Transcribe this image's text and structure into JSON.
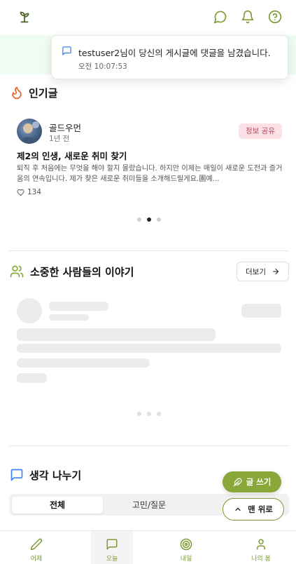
{
  "notification": {
    "message": "testuser2님이 당신의 게시글에 댓글을 남겼습니다.",
    "time": "오전 10:07:53"
  },
  "popular": {
    "title": "인기글",
    "post": {
      "author": "골드우먼",
      "time": "1년 전",
      "tag": "정보 공유",
      "title": "제2의 인생, 새로운 취미 찾기",
      "body": "퇴직 후 처음에는 무엇을 해야 할지 몰랐습니다. 하지만 이제는 매일이 새로운 도전과 즐거움의 연속입니다. 제가 찾은 새로운 취미들을 소개해드릴게요.園예...",
      "likes": "134"
    },
    "carousel": {
      "count": 3,
      "active": 2
    }
  },
  "stories": {
    "title": "소중한 사람들의 이야기",
    "more_label": "더보기",
    "carousel": {
      "count": 3,
      "active": 0
    }
  },
  "thoughts": {
    "title": "생각 나누기",
    "tabs": [
      "전체",
      "고민/질문"
    ],
    "active_tab": 0
  },
  "floating": {
    "write_label": "글 쓰기",
    "top_label": "맨 위로"
  },
  "nav": {
    "items": [
      {
        "label": "어제",
        "icon": "pencil-icon"
      },
      {
        "label": "오늘",
        "icon": "chat-icon"
      },
      {
        "label": "내일",
        "icon": "target-icon"
      },
      {
        "label": "나의 봄",
        "icon": "user-icon"
      }
    ],
    "active_index": 1
  },
  "colors": {
    "accent": "#8aa83a",
    "nav_label": "#7d9a33",
    "band": "#eefcf1",
    "tag_bg": "#fbe1e5",
    "tag_text": "#b8475c",
    "fire": "#e8632b",
    "chat_blue": "#3b82f6"
  }
}
